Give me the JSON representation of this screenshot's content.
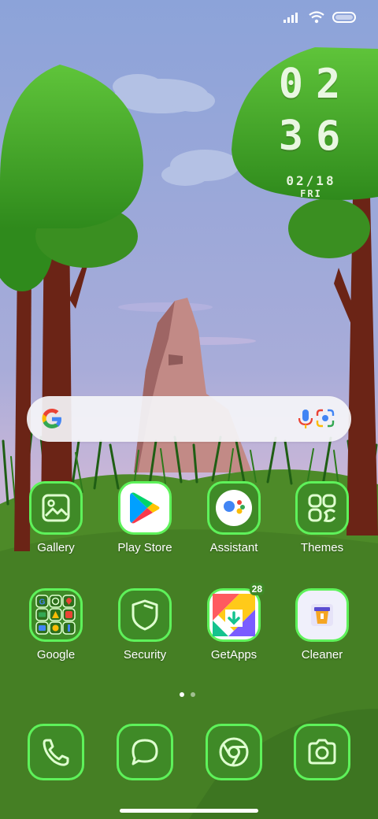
{
  "status_bar": {
    "icons": [
      "signal-icon",
      "wifi-icon",
      "battery-icon"
    ]
  },
  "clock": {
    "hour": "02",
    "minute": "36",
    "date": "02/18",
    "weekday": "FRI"
  },
  "search_bar": {
    "icons": [
      "google-logo",
      "mic-icon",
      "lens-icon"
    ]
  },
  "apps_row1": [
    {
      "label": "Gallery",
      "icon": "gallery-icon"
    },
    {
      "label": "Play Store",
      "icon": "play-store-icon"
    },
    {
      "label": "Assistant",
      "icon": "assistant-icon"
    },
    {
      "label": "Themes",
      "icon": "themes-icon"
    }
  ],
  "apps_row2": [
    {
      "label": "Google",
      "icon": "google-folder-icon"
    },
    {
      "label": "Security",
      "icon": "shield-icon"
    },
    {
      "label": "GetApps",
      "icon": "getapps-icon",
      "badge": "28"
    },
    {
      "label": "Cleaner",
      "icon": "cleaner-icon"
    }
  ],
  "dock": [
    {
      "icon": "phone-icon"
    },
    {
      "icon": "messages-icon"
    },
    {
      "icon": "chrome-icon"
    },
    {
      "icon": "camera-icon"
    }
  ],
  "page_indicator": {
    "pages": 2,
    "current": 1
  },
  "colors": {
    "icon_border": "#5ef25a",
    "icon_fill": "#3f8a27",
    "sky": "#8ea6d8",
    "grass": "#4f8a2a"
  }
}
